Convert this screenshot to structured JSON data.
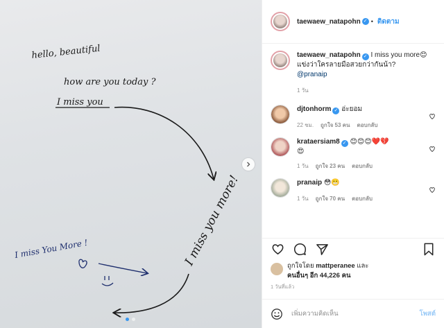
{
  "post": {
    "owner": "taewaew_natapohn",
    "follow_label": "ติดตาม",
    "caption_user": "taewaew_natapohn",
    "caption_text": "I miss you more",
    "caption_emoji": "😊",
    "caption_text2": "แข่งว่าใครลายมือสวยกว่ากันน้า?",
    "caption_mention": "@pranaip",
    "caption_age": "1 วัน"
  },
  "handwriting": {
    "line1": "hello, beautiful",
    "line2": "how are you today ?",
    "line3": "I miss you",
    "line4": "I miss you more!",
    "line5": "I miss You More !"
  },
  "comments": [
    {
      "user": "djtonhorm",
      "text": "อ่ะยอม",
      "age": "22 ชม.",
      "likes": "ถูกใจ 53 คน",
      "reply": "ตอบกลับ",
      "avatar_color": "#b57b5a"
    },
    {
      "user": "krataersiam8",
      "text": "😊😊😊❤️💔",
      "text2": "😍",
      "age": "1 วัน",
      "likes": "ถูกใจ 23 คน",
      "reply": "ตอบกลับ",
      "avatar_color": "#a94a4f"
    },
    {
      "user": "pranaip",
      "text": "😳😬",
      "age": "1 วัน",
      "likes": "ถูกใจ 70 คน",
      "reply": "ตอบกลับ",
      "avatar_color": "#c8cfc4"
    }
  ],
  "likes_line": {
    "prefix": "ถูกใจโดย",
    "user": "mattperanee",
    "and": "และ",
    "others": "คนอื่นๆ อีก 44,226 คน"
  },
  "timestamp": "1 วันที่แล้ว",
  "add_comment": {
    "placeholder": "เพิ่มความคิดเห็น",
    "post_label": "โพสต์"
  },
  "colors": {
    "accent": "#3897f0",
    "ink_black": "#1a1a1a",
    "ink_blue": "#1f2f6e"
  }
}
